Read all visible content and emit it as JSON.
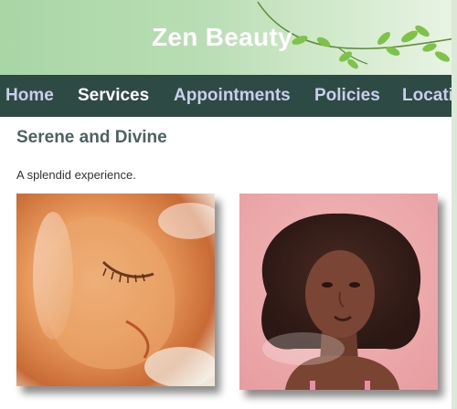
{
  "site": {
    "title": "Zen Beauty"
  },
  "nav": {
    "items": [
      {
        "label": "Home",
        "active": false
      },
      {
        "label": "Services",
        "active": true
      },
      {
        "label": "Appointments",
        "active": false
      },
      {
        "label": "Policies",
        "active": false
      },
      {
        "label": "Locati",
        "active": false
      }
    ]
  },
  "main": {
    "heading": "Serene and Divine",
    "subtext": "A splendid experience."
  },
  "colors": {
    "banner": "#a9d6a6",
    "nav_background": "#2e4a45",
    "nav_text": "#c7cfeb",
    "nav_active_text": "#ffffff",
    "heading": "#4d6260"
  },
  "images": [
    {
      "name": "face-mask-photo"
    },
    {
      "name": "woman-portrait-photo"
    }
  ]
}
